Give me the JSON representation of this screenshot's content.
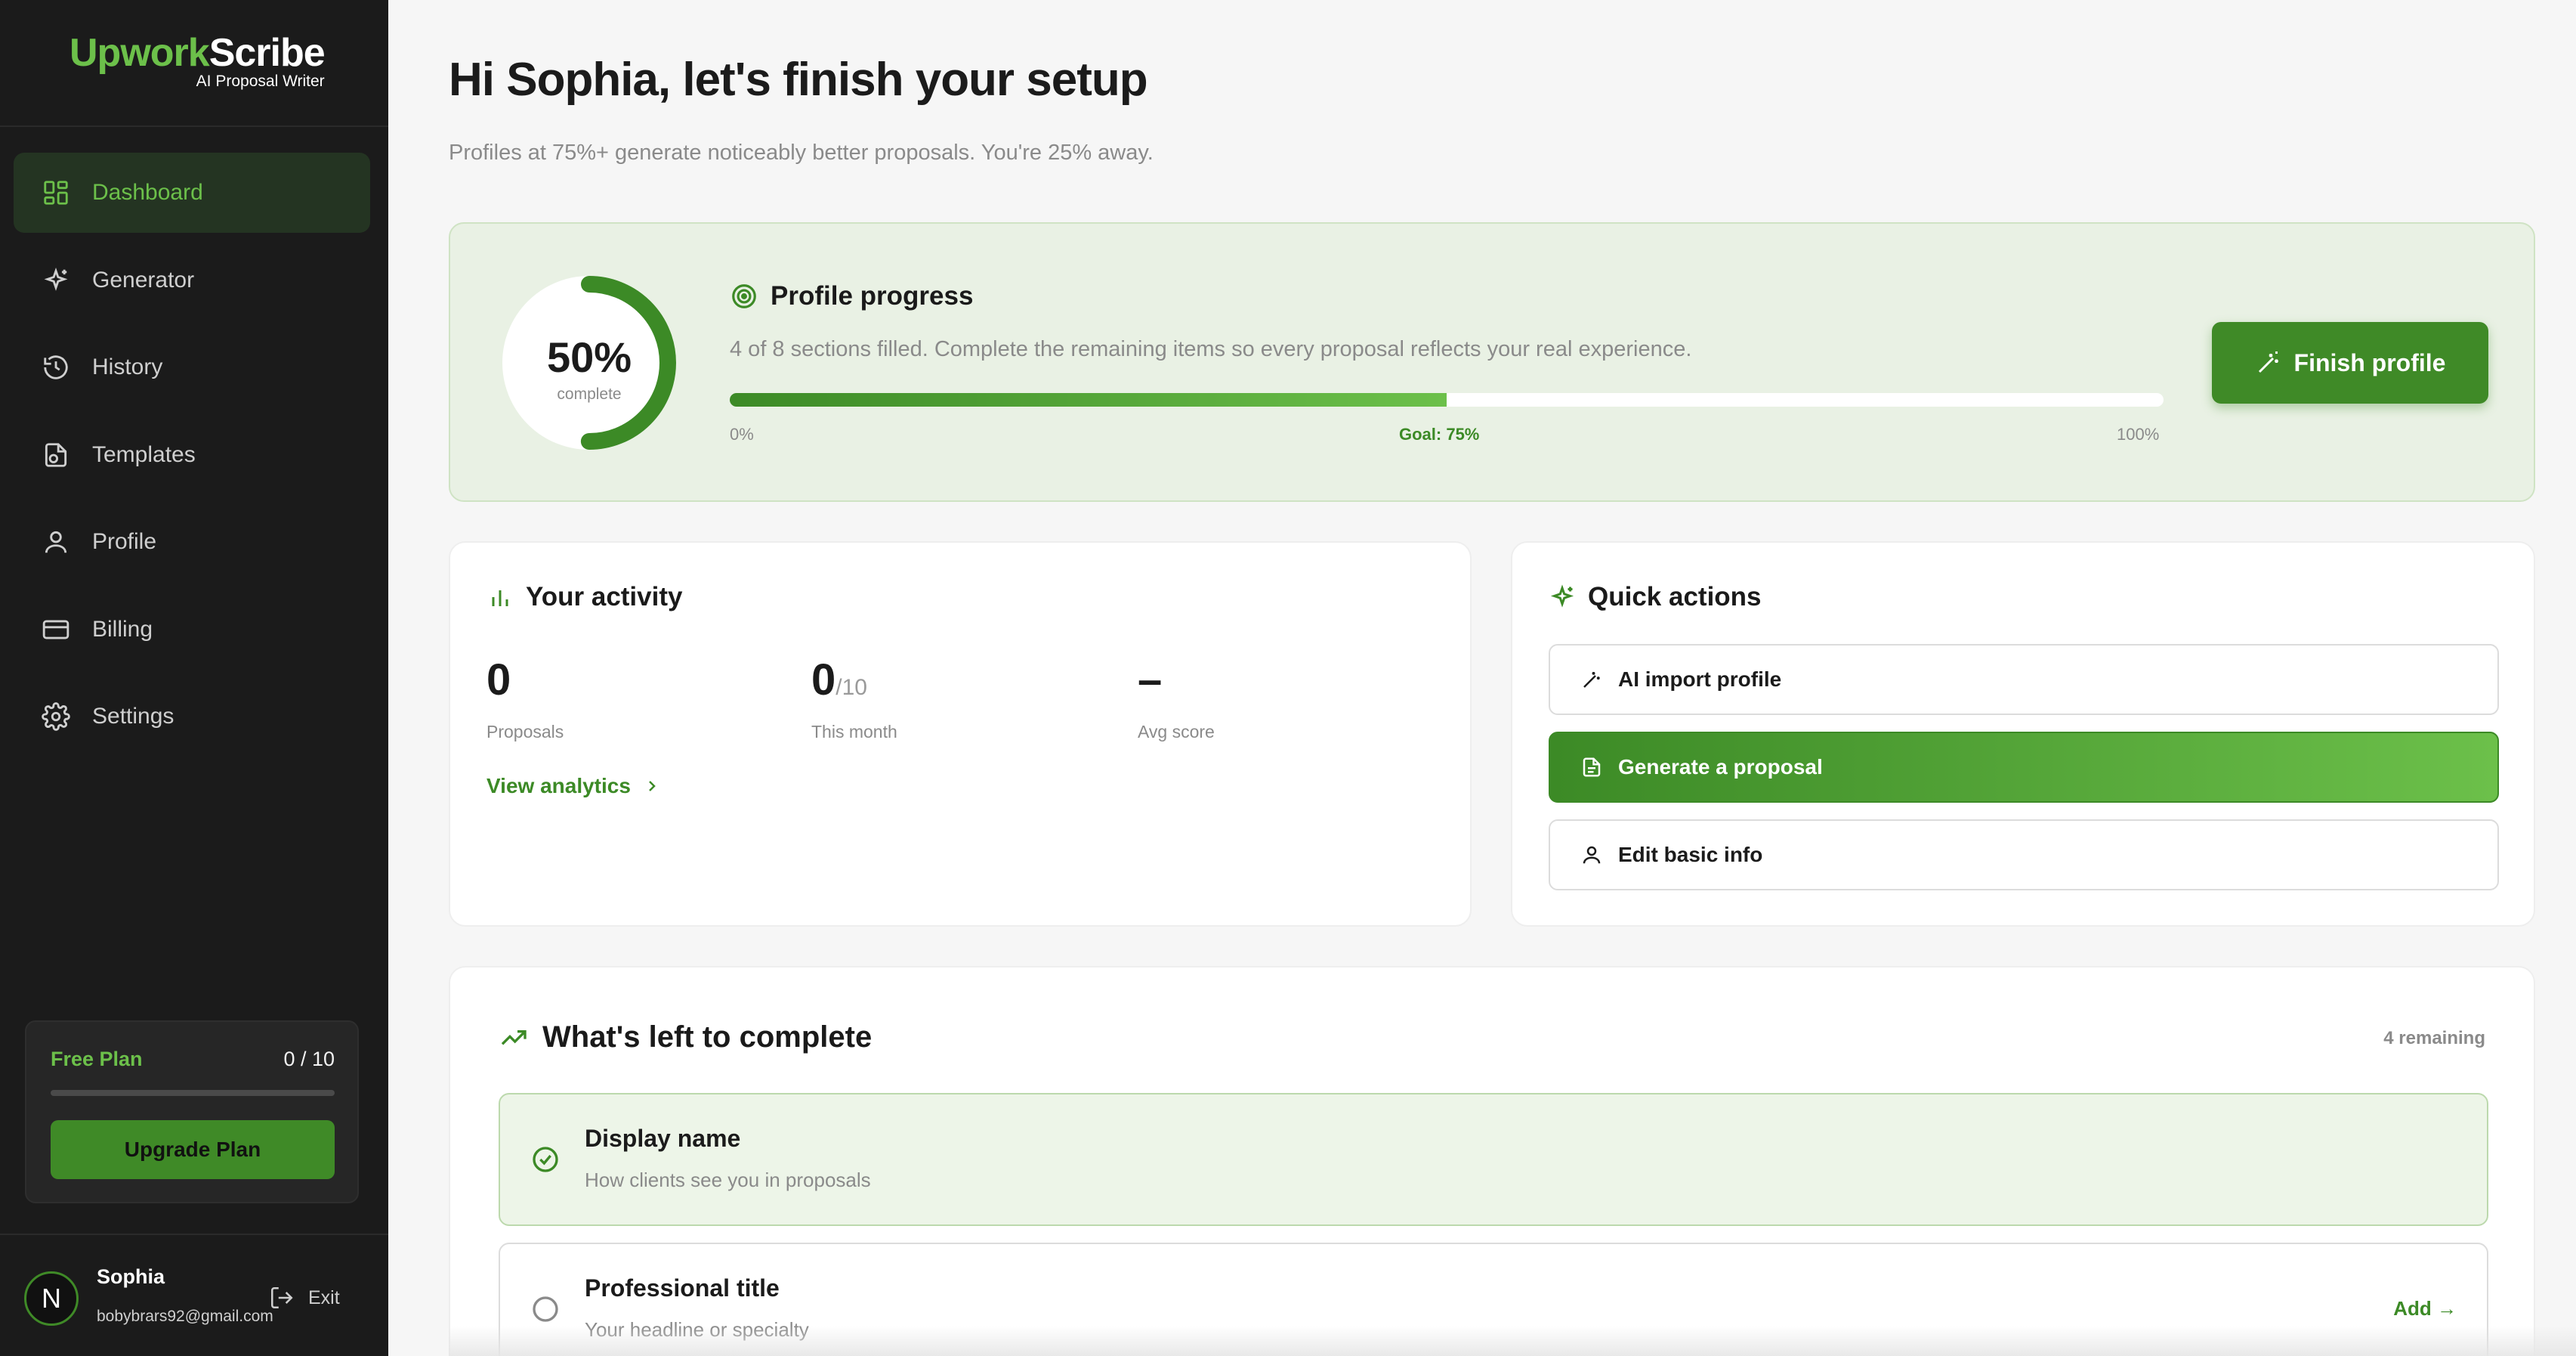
{
  "brand": {
    "name_part1": "Upwork",
    "name_part2": "Scribe",
    "tagline": "AI Proposal Writer",
    "accent": "#6cc04a",
    "accent_dark": "#3f8a27"
  },
  "sidebar": {
    "items": [
      {
        "label": "Dashboard",
        "icon": "dashboard-icon",
        "active": true
      },
      {
        "label": "Generator",
        "icon": "sparkle-icon"
      },
      {
        "label": "History",
        "icon": "history-icon"
      },
      {
        "label": "Templates",
        "icon": "templates-icon"
      },
      {
        "label": "Profile",
        "icon": "user-icon"
      },
      {
        "label": "Billing",
        "icon": "credit-card-icon"
      },
      {
        "label": "Settings",
        "icon": "gear-icon"
      }
    ],
    "plan": {
      "name": "Free Plan",
      "count": "0 / 10",
      "usage_fraction": 0,
      "upgrade_label": "Upgrade Plan"
    },
    "user": {
      "initial": "N",
      "name": "Sophia",
      "email": "bobybrars92@gmail.com",
      "exit_label": "Exit"
    }
  },
  "header": {
    "greeting": "Hi Sophia, let's finish your setup",
    "subtitle": "Profiles at 75%+ generate noticeably better proposals. You're 25% away."
  },
  "progress": {
    "percent_text": "50%",
    "percent_value": 0.5,
    "complete_label": "complete",
    "title": "Profile progress",
    "description": "4 of 8 sections filled. Complete the remaining items so every proposal reflects your real experience.",
    "label_min": "0%",
    "label_goal": "Goal: 75%",
    "label_max": "100%",
    "finish_label": "Finish profile"
  },
  "activity": {
    "title": "Your activity",
    "stats": [
      {
        "value": "0",
        "suffix": "",
        "label": "Proposals"
      },
      {
        "value": "0",
        "suffix": "/10",
        "label": "This month"
      },
      {
        "value": "–",
        "suffix": "",
        "label": "Avg score"
      }
    ],
    "view_analytics": "View analytics"
  },
  "quick_actions": {
    "title": "Quick actions",
    "items": [
      {
        "label": "AI import profile",
        "icon": "magic-wand-icon"
      },
      {
        "label": "Generate a proposal",
        "icon": "document-icon",
        "primary": true
      },
      {
        "label": "Edit basic info",
        "icon": "user-icon"
      }
    ]
  },
  "left_to_complete": {
    "title": "What's left to complete",
    "remaining": "4 remaining",
    "tasks": [
      {
        "title": "Display name",
        "subtitle": "How clients see you in proposals",
        "done": true
      },
      {
        "title": "Professional title",
        "subtitle": "Your headline or specialty",
        "done": false,
        "action": "Add →"
      }
    ]
  }
}
